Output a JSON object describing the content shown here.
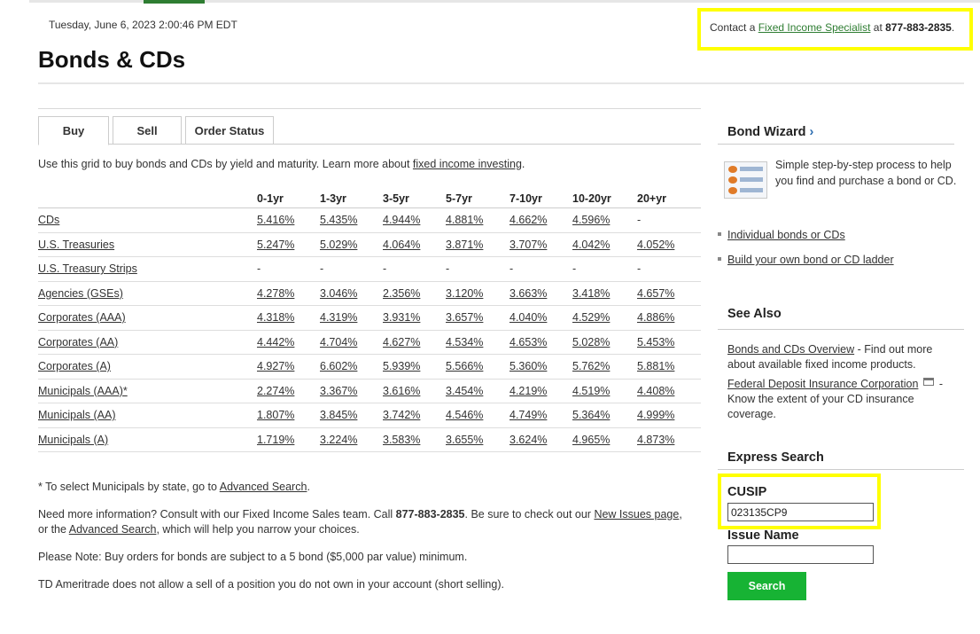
{
  "header": {
    "datetime": "Tuesday, June 6, 2023 2:00:46 PM EDT",
    "title": "Bonds & CDs",
    "contact_prefix": "Contact a ",
    "contact_link": "Fixed Income Specialist",
    "contact_mid": " at ",
    "contact_phone": "877-883-2835",
    "contact_suffix": "."
  },
  "tabs": [
    {
      "label": "Buy",
      "active": true
    },
    {
      "label": "Sell",
      "active": false
    },
    {
      "label": "Order Status",
      "active": false
    }
  ],
  "intro": {
    "text": "Use this grid to buy bonds and CDs by yield and maturity. Learn more about ",
    "link": "fixed income investing",
    "suffix": "."
  },
  "grid": {
    "columns": [
      "0-1yr",
      "1-3yr",
      "3-5yr",
      "5-7yr",
      "7-10yr",
      "10-20yr",
      "20+yr"
    ],
    "rows": [
      {
        "name": "CDs",
        "values": [
          "5.416%",
          "5.435%",
          "4.944%",
          "4.881%",
          "4.662%",
          "4.596%",
          "-"
        ]
      },
      {
        "name": "U.S. Treasuries",
        "values": [
          "5.247%",
          "5.029%",
          "4.064%",
          "3.871%",
          "3.707%",
          "4.042%",
          "4.052%"
        ]
      },
      {
        "name": "U.S. Treasury Strips",
        "values": [
          "-",
          "-",
          "-",
          "-",
          "-",
          "-",
          "-"
        ]
      },
      {
        "name": "Agencies (GSEs)",
        "values": [
          "4.278%",
          "3.046%",
          "2.356%",
          "3.120%",
          "3.663%",
          "3.418%",
          "4.657%"
        ]
      },
      {
        "name": "Corporates (AAA)",
        "values": [
          "4.318%",
          "4.319%",
          "3.931%",
          "3.657%",
          "4.040%",
          "4.529%",
          "4.886%"
        ]
      },
      {
        "name": "Corporates (AA)",
        "values": [
          "4.442%",
          "4.704%",
          "4.627%",
          "4.534%",
          "4.653%",
          "5.028%",
          "5.453%"
        ]
      },
      {
        "name": "Corporates (A)",
        "values": [
          "4.927%",
          "6.602%",
          "5.939%",
          "5.566%",
          "5.360%",
          "5.762%",
          "5.881%"
        ]
      },
      {
        "name": "Municipals (AAA)*",
        "values": [
          "2.274%",
          "3.367%",
          "3.616%",
          "3.454%",
          "4.219%",
          "4.519%",
          "4.408%"
        ]
      },
      {
        "name": "Municipals (AA)",
        "values": [
          "1.807%",
          "3.845%",
          "3.742%",
          "4.546%",
          "4.749%",
          "5.364%",
          "4.999%"
        ]
      },
      {
        "name": "Municipals (A)",
        "values": [
          "1.719%",
          "3.224%",
          "3.583%",
          "3.655%",
          "3.624%",
          "4.965%",
          "4.873%"
        ]
      }
    ]
  },
  "notes": {
    "n1_text": "* To select Municipals by state, go to ",
    "n1_link": "Advanced Search",
    "n1_suffix": ".",
    "n2_text": "Need more information? Consult with our Fixed Income Sales team. Call ",
    "n2_phone": "877-883-2835",
    "n2_mid": ". Be sure to check out our ",
    "n2_link1": "New Issues page",
    "n2_mid2": ", or the ",
    "n2_link2": "Advanced Search",
    "n2_suffix": ", which will help you narrow your choices.",
    "n3": "Please Note: Buy orders for bonds are subject to a 5 bond ($5,000 par value) minimum.",
    "n4": "TD Ameritrade does not allow a sell of a position you do not own in your account (short selling)."
  },
  "sidebar": {
    "wizard_title": "Bond Wizard",
    "wizard_arrow": "›",
    "wizard_text": "Simple step-by-step process to help you find and purchase a bond or CD.",
    "wizard_link1": "Individual bonds or CDs",
    "wizard_link2": "Build your own bond or CD ladder",
    "see_also_title": "See Also",
    "see1_link": "Bonds and CDs Overview",
    "see1_text": " - Find out more about available fixed income products.",
    "see2_link": "Federal Deposit Insurance Corporation",
    "see2_text": " - Know the extent of your CD insurance coverage.",
    "express_title": "Express Search",
    "cusip_label": "CUSIP",
    "cusip_value": "023135CP9",
    "issue_label": "Issue Name",
    "issue_value": "",
    "search_label": "Search"
  },
  "colors": {
    "accent_green": "#17b334",
    "link_green": "#2e7d32",
    "highlight": "#ffff00"
  }
}
